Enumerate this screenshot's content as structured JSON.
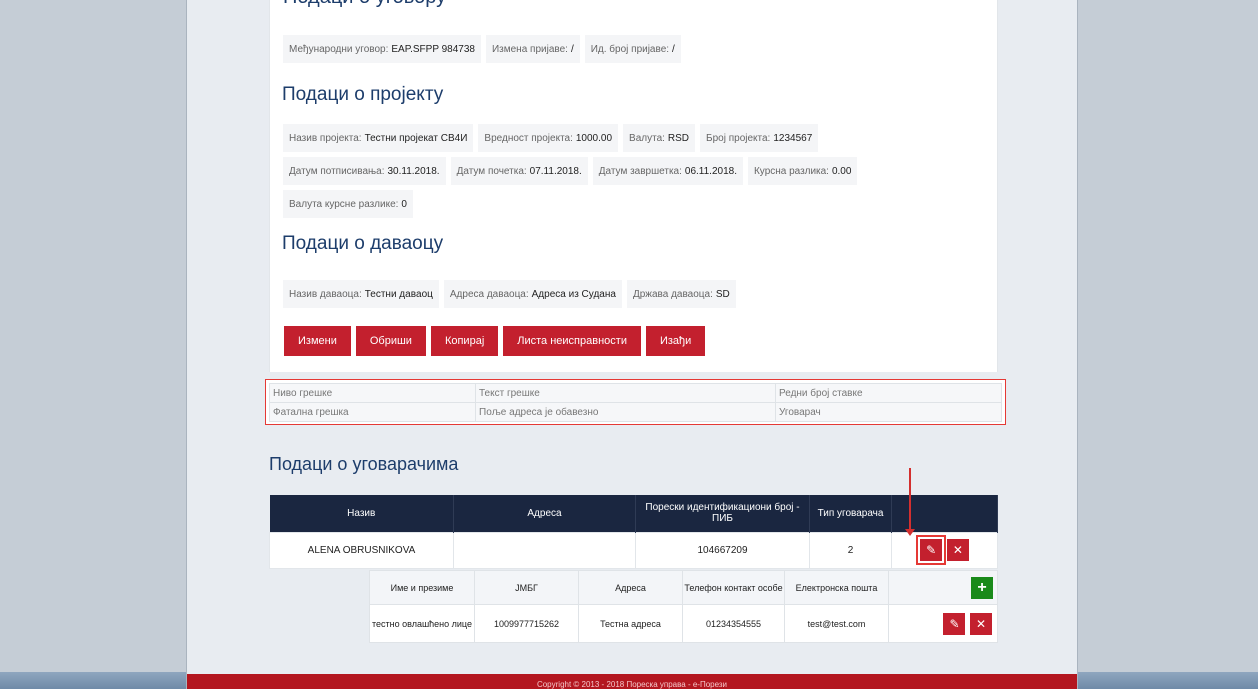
{
  "cut_title": "Подаци о уговору",
  "contract": [
    {
      "label": "Међународни уговор:",
      "value": "EAP.SFPP 984738"
    },
    {
      "label": "Измена пријаве:",
      "value": "/"
    },
    {
      "label": "Ид. број пријаве:",
      "value": "/"
    }
  ],
  "project_title": "Подаци о пројекту",
  "project_row1": [
    {
      "label": "Назив пројекта:",
      "value": "Тестни пројекат СВ4И"
    },
    {
      "label": "Вредност пројекта:",
      "value": "1000.00"
    },
    {
      "label": "Валута:",
      "value": "RSD"
    },
    {
      "label": "Број пројекта:",
      "value": "1234567"
    }
  ],
  "project_row2": [
    {
      "label": "Датум потписивања:",
      "value": "30.11.2018."
    },
    {
      "label": "Датум почетка:",
      "value": "07.11.2018."
    },
    {
      "label": "Датум завршетка:",
      "value": "06.11.2018."
    },
    {
      "label": "Курсна разлика:",
      "value": "0.00"
    }
  ],
  "project_row3": [
    {
      "label": "Валута курсне разлике:",
      "value": "0"
    }
  ],
  "donor_title": "Подаци о даваоцу",
  "donor": [
    {
      "label": "Назив даваоца:",
      "value": "Тестни давaоц"
    },
    {
      "label": "Адреса даваоца:",
      "value": "Адреса из Судана"
    },
    {
      "label": "Држава даваоца:",
      "value": "SD"
    }
  ],
  "buttons": {
    "edit": "Измени",
    "delete": "Обриши",
    "copy": "Копирај",
    "errors": "Листа неисправности",
    "exit": "Изађи"
  },
  "errors": {
    "headers": [
      "Ниво грешке",
      "Текст грешке",
      "Редни број ставке"
    ],
    "rows": [
      [
        "Фатална грешка",
        "Поље адреса је обавезно",
        "Уговарач"
      ]
    ]
  },
  "contractors_title": "Подаци о уговарачима",
  "contractors": {
    "headers": [
      "Назив",
      "Адреса",
      "Порески идентификациони број - ПИБ",
      "Тип уговарача"
    ],
    "row": {
      "name": "ALENA OBRUSNIKOVA",
      "address": "",
      "pib": "104667209",
      "type": "2"
    }
  },
  "persons": {
    "headers": [
      "Име и презиме",
      "ЈМБГ",
      "Адреса",
      "Телефон контакт особе",
      "Електронска пошта"
    ],
    "row": {
      "name": "тестно овлашћено лице",
      "jmbg": "1009977715262",
      "address": "Тестна адреса",
      "phone": "01234354555",
      "email": "test@test.com"
    }
  },
  "icons": {
    "edit": "pencil-icon",
    "remove": "close-icon",
    "add": "plus-icon"
  },
  "colors": {
    "accent": "#c3202e",
    "header_dark": "#1a2640",
    "title": "#1d3d6b",
    "add": "#1a8a1a"
  },
  "footer": "Copyright © 2013 - 2018 Пореска управа - е-Порези"
}
